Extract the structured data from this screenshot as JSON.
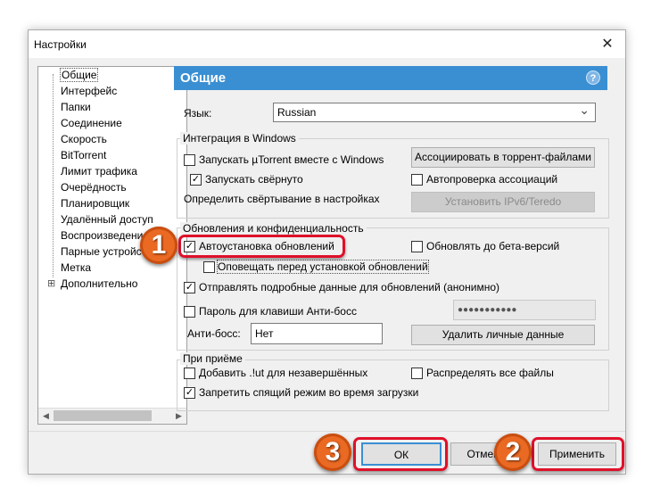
{
  "window": {
    "title": "Настройки",
    "close_glyph": "✕"
  },
  "tree": {
    "items": [
      {
        "label": "Общие"
      },
      {
        "label": "Интерфейс"
      },
      {
        "label": "Папки"
      },
      {
        "label": "Соединение"
      },
      {
        "label": "Скорость"
      },
      {
        "label": "BitTorrent"
      },
      {
        "label": "Лимит трафика"
      },
      {
        "label": "Очерёдность"
      },
      {
        "label": "Планировщик"
      },
      {
        "label": "Удалённый доступ"
      },
      {
        "label": "Воспроизведение"
      },
      {
        "label": "Парные устройства"
      },
      {
        "label": "Метка"
      },
      {
        "label": "Дополнительно"
      }
    ],
    "expand_glyph": "⊞",
    "scroll_left": "◀",
    "scroll_right": "▶"
  },
  "header": {
    "title": "Общие",
    "help": "?"
  },
  "language": {
    "label": "Язык:",
    "value": "Russian",
    "arrow": "⌄"
  },
  "integration": {
    "legend": "Интеграция в Windows",
    "start_with_windows": {
      "label": "Запускать µTorrent вместе с Windows",
      "checked": false
    },
    "start_minimized": {
      "label": "Запускать свёрнуто",
      "checked": true
    },
    "define_minimize": "Определить свёртывание в настройках",
    "associate_button": "Ассоциировать в торрент-файлами",
    "auto_check_assoc": {
      "label": "Автопроверка ассоциаций",
      "checked": false
    },
    "install_ipv6_button": "Установить IPv6/Teredo"
  },
  "updates": {
    "legend": "Обновления и конфиденциальность",
    "auto_update": {
      "label": "Автоустановка обновлений",
      "checked": true
    },
    "beta": {
      "label": "Обновлять до бета-версий",
      "checked": false
    },
    "notify_before": {
      "label": "Оповещать перед установкой обновлений",
      "checked": false
    },
    "send_data": {
      "label": "Отправлять подробные данные для обновлений (анонимно)",
      "checked": true
    },
    "boss_password": {
      "label": "Пароль для клавиши Анти-босс",
      "checked": false
    },
    "password_mask": "●●●●●●●●●●●",
    "boss_key_label": "Анти-босс:",
    "boss_key_value": "Нет",
    "delete_personal_button": "Удалить личные данные"
  },
  "receive": {
    "legend": "При приёме",
    "add_ut": {
      "label": "Добавить .!ut для незавершённых",
      "checked": false
    },
    "distribute": {
      "label": "Распределять все файлы",
      "checked": false
    },
    "no_sleep": {
      "label": "Запретить спящий режим во время загрузки",
      "checked": true
    }
  },
  "footer": {
    "ok": "ОК",
    "cancel": "Отмена",
    "apply": "Применить"
  },
  "annotations": {
    "badge1": "1",
    "badge2": "2",
    "badge3": "3",
    "check": "✓"
  }
}
